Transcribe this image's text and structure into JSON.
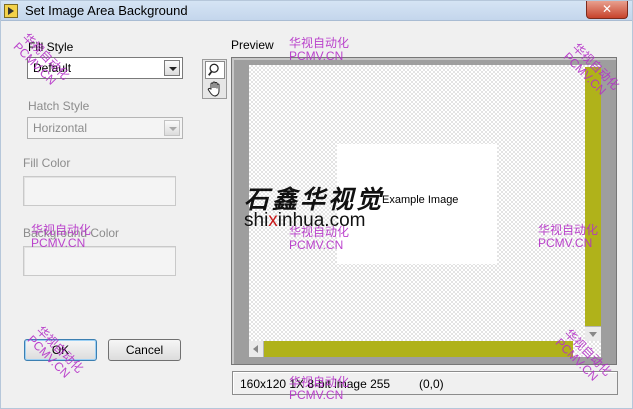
{
  "window": {
    "title": "Set Image Area Background",
    "close_label": "✕"
  },
  "left_panel": {
    "fill_style": {
      "label": "Fill Style",
      "value": "Default"
    },
    "hatch_style": {
      "label": "Hatch Style",
      "value": "Horizontal"
    },
    "fill_color": {
      "label": "Fill Color"
    },
    "background_color": {
      "label": "Background Color"
    },
    "ok_label": "OK",
    "cancel_label": "Cancel"
  },
  "preview": {
    "label": "Preview",
    "tools": [
      "zoom-icon",
      "pan-hand-icon"
    ],
    "example_label": "Example Image",
    "status_info": "160x120 1X 8-bit image 255",
    "status_coords": "(0,0)",
    "scrollbar_color": "#b0b21a"
  },
  "watermarks": {
    "cn": "华视自动化",
    "en": "PCMV.CN",
    "color": "#b530c8"
  },
  "logo": {
    "calligraphy": "石鑫华视觉",
    "url_pre": "shi",
    "url_accent": "x",
    "url_post": "inhua.com"
  }
}
